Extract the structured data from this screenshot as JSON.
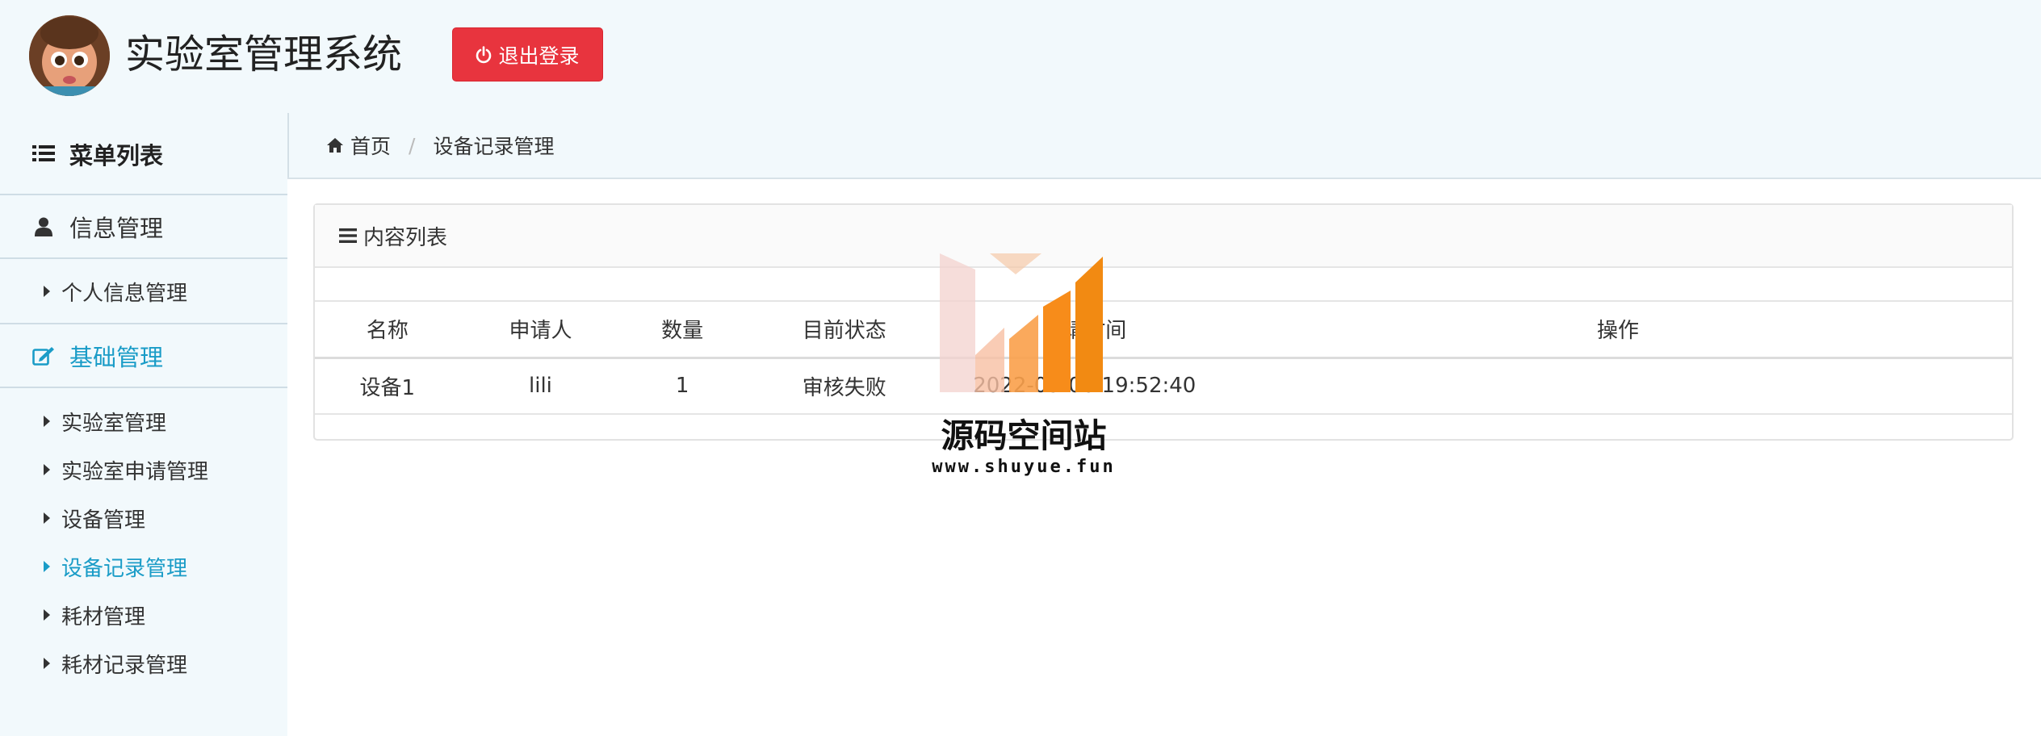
{
  "header": {
    "app_title": "实验室管理系统",
    "logout_label": "退出登录",
    "logout_color": "#e8343e"
  },
  "sidebar": {
    "heading": "菜单列表",
    "groups": [
      {
        "label": "信息管理",
        "icon": "user-icon",
        "items": [
          "个人信息管理"
        ]
      },
      {
        "label": "基础管理",
        "icon": "edit-icon",
        "active": true,
        "items": [
          "实验室管理",
          "实验室申请管理",
          "设备管理",
          "设备记录管理",
          "耗材管理",
          "耗材记录管理"
        ]
      }
    ],
    "active_item": "设备记录管理",
    "accent_color": "#1a9cc7"
  },
  "breadcrumb": {
    "home": "首页",
    "current": "设备记录管理"
  },
  "panel": {
    "title": "内容列表",
    "columns": [
      "名称",
      "申请人",
      "数量",
      "目前状态",
      "申请时间",
      "操作"
    ],
    "rows": [
      {
        "name": "设备1",
        "applicant": "lili",
        "quantity": "1",
        "status": "审核失败",
        "time": "2022-03-06 19:52:40",
        "action": ""
      }
    ]
  },
  "watermark": {
    "title": "源码空间站",
    "url": "www.shuyue.fun"
  }
}
